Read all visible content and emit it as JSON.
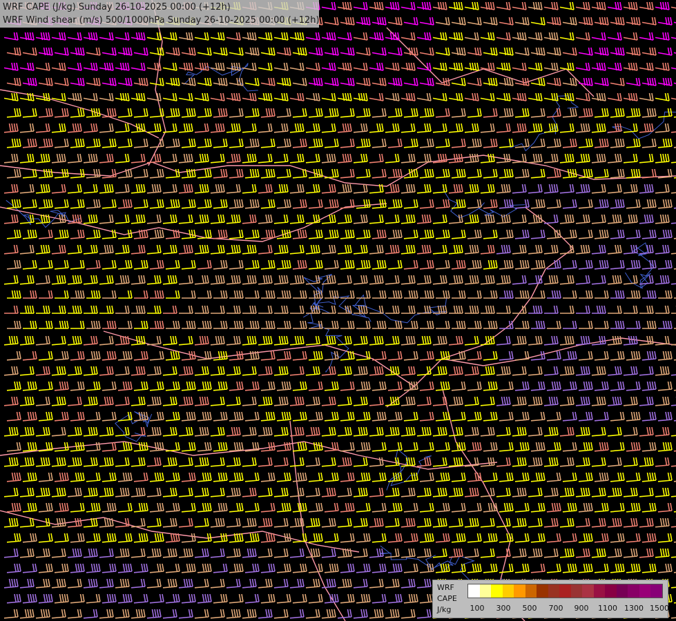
{
  "header": {
    "line1": "WRF CAPE (J/kg) Sunday 26-10-2025 00:00 (+12h)",
    "line2": "WRF Wind shear (m/s) 500/1000hPa Sunday 26-10-2025 00:00 (+12h)"
  },
  "legend": {
    "label1": "WRF",
    "label2": "CAPE",
    "unit": "J/kg",
    "colors": [
      "#ffffff",
      "#ffff99",
      "#ffff00",
      "#ffcc00",
      "#ff9900",
      "#cc6600",
      "#993300",
      "#993322",
      "#aa2222",
      "#993333",
      "#aa3344",
      "#991144",
      "#880044",
      "#770055",
      "#880066",
      "#990077",
      "#880077"
    ],
    "ticks": [
      "100",
      "300",
      "500",
      "700",
      "900",
      "1100",
      "1300",
      "1500"
    ]
  },
  "map": {
    "palette": {
      "yellow": "#ffff00",
      "tan": "#e0a878",
      "salmon": "#f08070",
      "magenta": "#ff00ff",
      "violet": "#a070e0",
      "pink": "#ff6699"
    },
    "borders": "#ff99aa",
    "rivers": "#4060d0"
  }
}
